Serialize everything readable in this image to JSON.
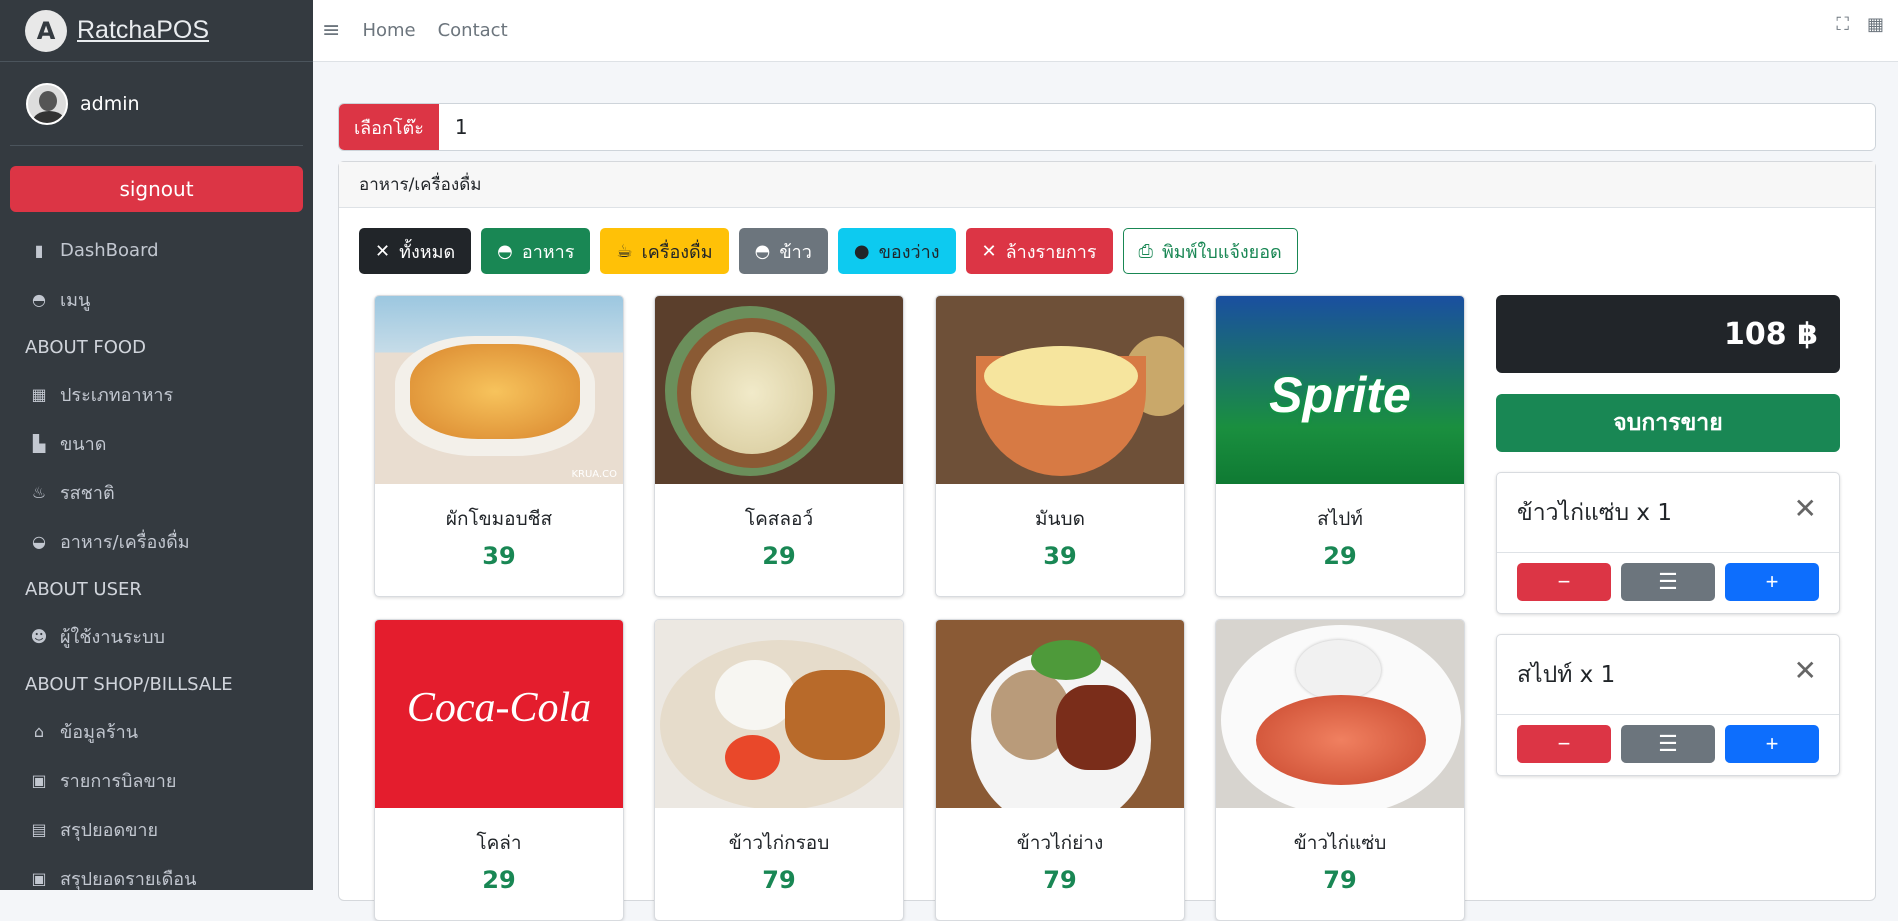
{
  "brand": {
    "name": "RatchaPOS",
    "logo_letter": "A"
  },
  "user": {
    "name": "admin"
  },
  "sidebar": {
    "signout_label": "signout",
    "items": [
      {
        "label": "DashBoard",
        "icon": "chart-bar-icon",
        "glyph": "▮"
      },
      {
        "label": "เมนู",
        "icon": "bowl-icon",
        "glyph": "◓"
      }
    ],
    "sections": [
      {
        "header": "ABOUT FOOD",
        "items": [
          {
            "label": "ประเภทอาหาร",
            "icon": "table-icon",
            "glyph": "▦"
          },
          {
            "label": "ขนาด",
            "icon": "file-icon",
            "glyph": "▙"
          },
          {
            "label": "รสชาติ",
            "icon": "fire-icon",
            "glyph": "♨"
          },
          {
            "label": "อาหาร/เครื่องดื่ม",
            "icon": "bowl-rice-icon",
            "glyph": "◒"
          }
        ]
      },
      {
        "header": "ABOUT USER",
        "items": [
          {
            "label": "ผู้ใช้งานระบบ",
            "icon": "user-icon",
            "glyph": "☻"
          }
        ]
      },
      {
        "header": "ABOUT SHOP/BILLSALE",
        "items": [
          {
            "label": "ข้อมูลร้าน",
            "icon": "shop-icon",
            "glyph": "⌂"
          },
          {
            "label": "รายการบิลขาย",
            "icon": "money-icon",
            "glyph": "▣"
          },
          {
            "label": "สรุปยอดขาย",
            "icon": "card-icon",
            "glyph": "▤"
          },
          {
            "label": "สรุปยอดรายเดือน",
            "icon": "money-bills-icon",
            "glyph": "▣"
          }
        ]
      }
    ]
  },
  "topbar": {
    "links": [
      "Home",
      "Contact"
    ]
  },
  "table_select": {
    "label": "เลือกโต๊ะ",
    "value": "1"
  },
  "card": {
    "header": "อาหาร/เครื่องดื่ม"
  },
  "filters": [
    {
      "label": "ทั้งหมด",
      "icon": "utensils-icon",
      "glyph": "🍴",
      "color": "#212529"
    },
    {
      "label": "อาหาร",
      "icon": "bowl-food-icon",
      "glyph": "◓",
      "color": "#198754"
    },
    {
      "label": "เครื่องดื่ม",
      "icon": "mug-icon",
      "glyph": "☕",
      "color": "#ffc107"
    },
    {
      "label": "ข้าว",
      "icon": "bowl-rice-icon",
      "glyph": "◓",
      "color": "#6c757d"
    },
    {
      "label": "ของว่าง",
      "icon": "cookie-icon",
      "glyph": "●",
      "color": "#0dcaf0"
    },
    {
      "label": "ล้างรายการ",
      "icon": "close-icon",
      "glyph": "✕",
      "color": "#dc3545"
    },
    {
      "label": "พิมพ์ใบแจ้งยอด",
      "icon": "print-icon",
      "glyph": "⎙",
      "color": "#198754"
    }
  ],
  "products": [
    {
      "name": "ผักโขมอบชีส",
      "price": "39"
    },
    {
      "name": "โคสลอว์",
      "price": "29"
    },
    {
      "name": "มันบด",
      "price": "39"
    },
    {
      "name": "สไปท์",
      "price": "29"
    },
    {
      "name": "โคล่า",
      "price": "29"
    },
    {
      "name": "ข้าวไก่กรอบ",
      "price": "79"
    },
    {
      "name": "ข้าวไก่ย่าง",
      "price": "79"
    },
    {
      "name": "ข้าวไก่แซ่บ",
      "price": "79"
    }
  ],
  "images": {
    "watermark": "KRUA.CO",
    "sprite_text": "Sprite",
    "coke_text": "Coca-Cola"
  },
  "order": {
    "total": "108 ฿",
    "finish_label": "จบการขาย",
    "items": [
      {
        "text": "ข้าวไก่แซ่บ x 1"
      },
      {
        "text": "สไปท์ x 1"
      }
    ]
  },
  "colors": {
    "danger": "#dc3545",
    "success": "#198754",
    "secondary": "#6c757d",
    "primary": "#0d6efd",
    "dark": "#212529"
  }
}
